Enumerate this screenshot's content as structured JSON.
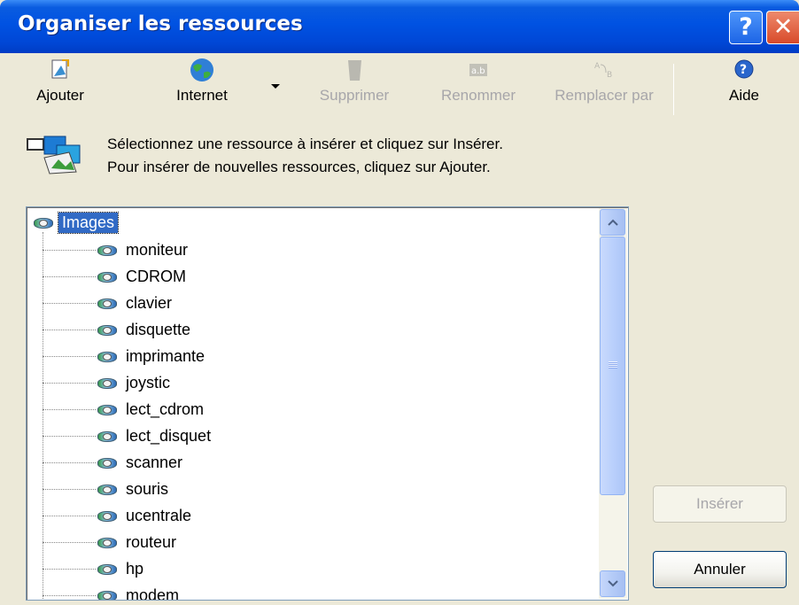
{
  "window": {
    "title": "Organiser les ressources",
    "help_glyph": "?",
    "close_glyph": "✕"
  },
  "toolbar": [
    {
      "label": "Ajouter",
      "icon": "add-resource-icon",
      "enabled": true
    },
    {
      "label": "Internet",
      "icon": "globe-icon",
      "enabled": true
    },
    {
      "label": "Supprimer",
      "icon": "delete-icon",
      "enabled": false
    },
    {
      "label": "Renommer",
      "icon": "rename-icon",
      "enabled": false
    },
    {
      "label": "Remplacer par",
      "icon": "replace-icon",
      "enabled": false
    },
    {
      "label": "Aide",
      "icon": "help-icon",
      "enabled": true
    }
  ],
  "instructions": {
    "line1": "Sélectionnez une ressource à insérer et cliquez sur Insérer.",
    "line2": "Pour insérer de nouvelles ressources, cliquez sur Ajouter."
  },
  "tree": {
    "root": "Images",
    "items": [
      "moniteur",
      "CDROM",
      "clavier",
      "disquette",
      "imprimante",
      "joystic",
      "lect_cdrom",
      "lect_disquet",
      "scanner",
      "souris",
      "ucentrale",
      "routeur",
      "hp",
      "modem"
    ]
  },
  "buttons": {
    "insert": "Insérer",
    "cancel": "Annuler"
  },
  "colors": {
    "title_bar": "#0052e2",
    "selection": "#316ac5",
    "disabled_text": "#a7a6aa",
    "window_bg": "#ece9d8"
  }
}
